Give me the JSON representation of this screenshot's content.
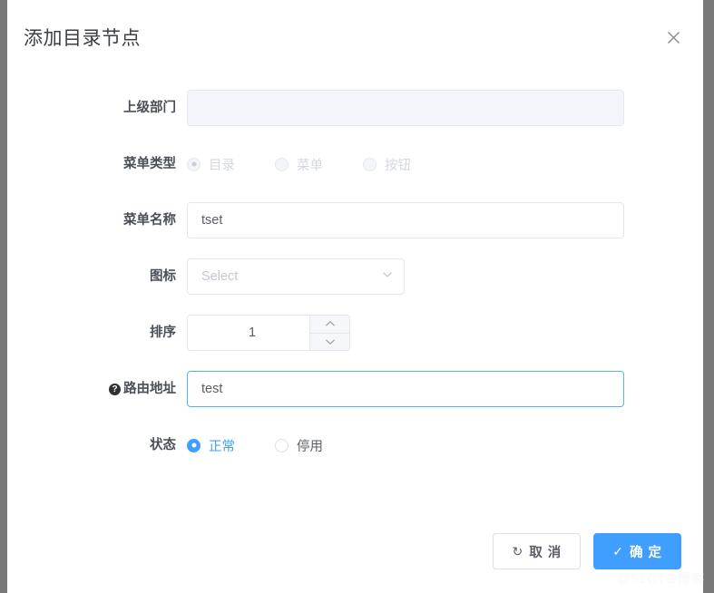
{
  "dialog": {
    "title": "添加目录节点",
    "close_icon": "close-icon"
  },
  "form": {
    "rows": {
      "parent": {
        "label": "上级部门",
        "value": "",
        "placeholder": ""
      },
      "menu_type": {
        "label": "菜单类型",
        "options": [
          {
            "label": "目录",
            "checked": true,
            "disabled": true
          },
          {
            "label": "菜单",
            "checked": false,
            "disabled": true
          },
          {
            "label": "按钮",
            "checked": false,
            "disabled": true
          }
        ]
      },
      "menu_name": {
        "label": "菜单名称",
        "value": "tset",
        "placeholder": ""
      },
      "icon": {
        "label": "图标",
        "value": "",
        "placeholder": "Select",
        "chevron_icon": "chevron-down-icon"
      },
      "sort": {
        "label": "排序",
        "value": "1",
        "up_icon": "chevron-up-icon",
        "down_icon": "chevron-down-icon"
      },
      "route": {
        "label": "路由地址",
        "help_icon": "question-mark-icon",
        "help_glyph": "?",
        "value": "test",
        "focused": true
      },
      "status": {
        "label": "状态",
        "options": [
          {
            "label": "正常",
            "checked": true,
            "disabled": false
          },
          {
            "label": "停用",
            "checked": false,
            "disabled": false
          }
        ]
      }
    }
  },
  "footer": {
    "cancel_label": "取 消",
    "cancel_icon": "refresh-icon",
    "cancel_glyph": "↻",
    "confirm_label": "确 定",
    "confirm_icon": "check-icon",
    "confirm_glyph": "✓"
  },
  "watermark": {
    "text": "@51CTO博客"
  },
  "colors": {
    "primary": "#409eff",
    "focus_border": "#59b0ee",
    "backdrop": "#797979",
    "label_text": "#4a4f57"
  }
}
